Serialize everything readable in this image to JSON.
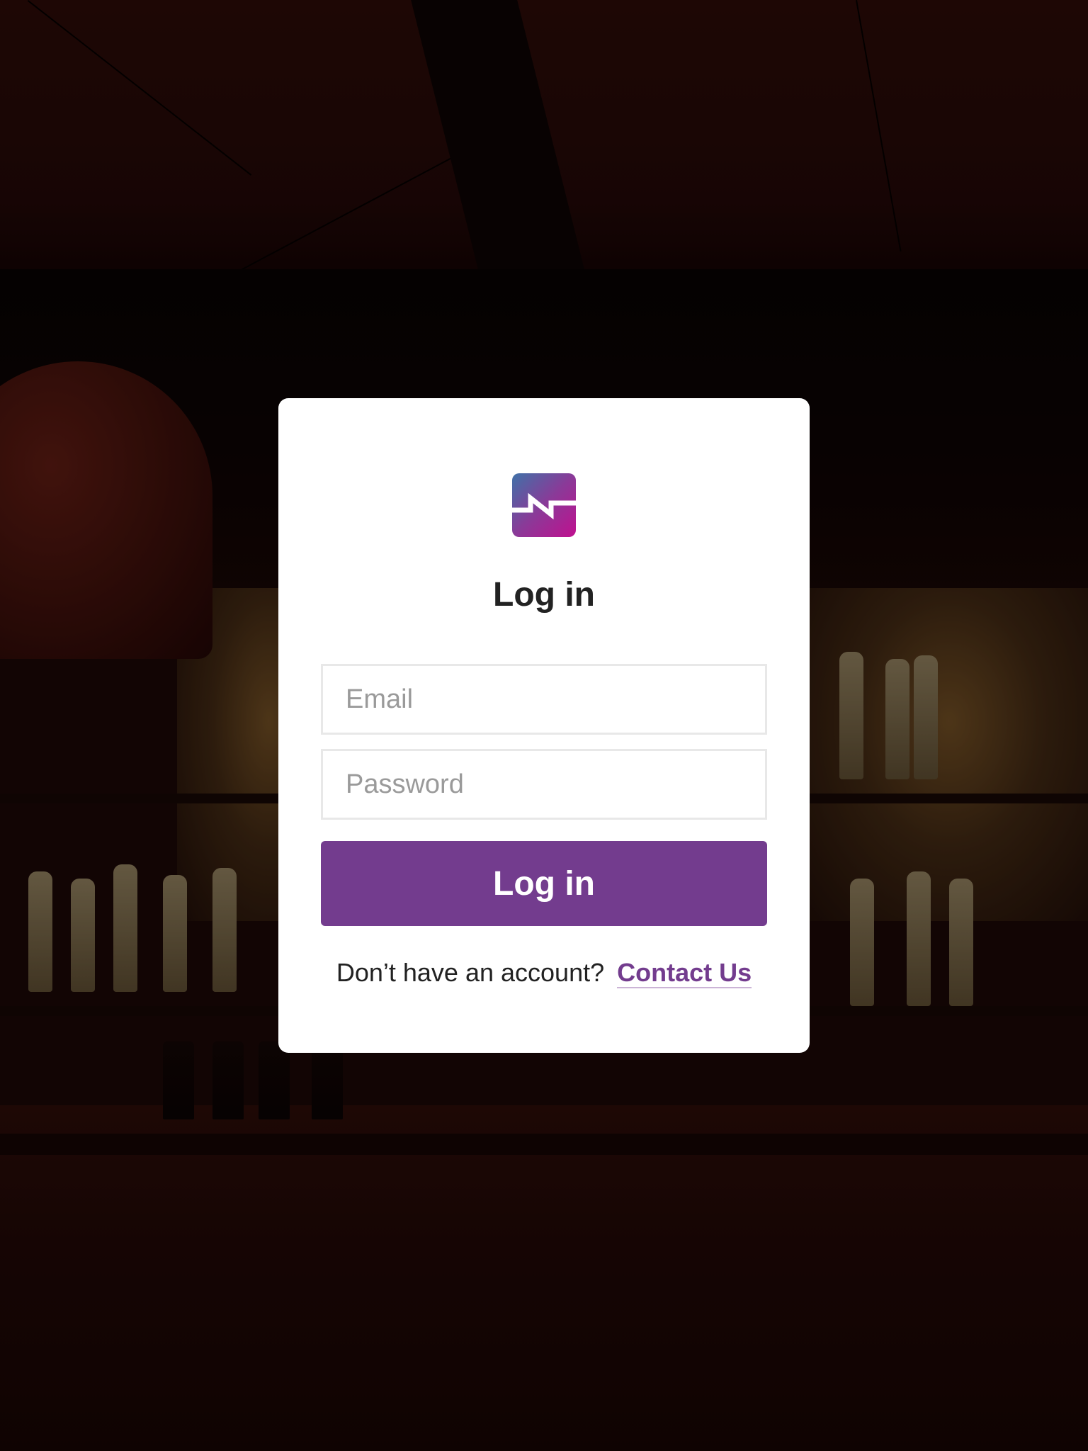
{
  "login": {
    "title": "Log in",
    "email_placeholder": "Email",
    "password_placeholder": "Password",
    "submit_label": "Log in",
    "signup_prompt": "Don’t have an account?",
    "contact_link": "Contact Us"
  },
  "logo": {
    "icon": "app-logo-icon",
    "gradient": [
      "#3f72a8",
      "#c0108f"
    ]
  },
  "colors": {
    "accent": "#733c8e",
    "card": "#ffffff",
    "field_border": "#e8e8e8",
    "placeholder": "#9a9a9a"
  }
}
